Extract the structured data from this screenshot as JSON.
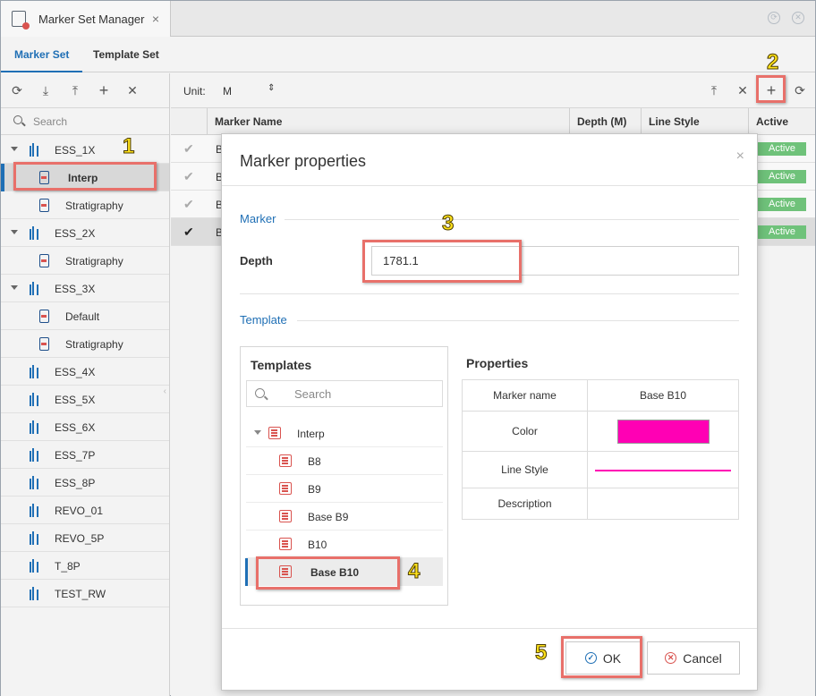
{
  "window": {
    "title": "Marker Set Manager",
    "close_glyph": "×",
    "controls": [
      "refresh-icon",
      "close-circle-icon"
    ]
  },
  "tabs": [
    {
      "label": "Marker Set",
      "active": true
    },
    {
      "label": "Template Set",
      "active": false
    }
  ],
  "left_toolbar": {
    "icons": [
      "refresh-icon",
      "import-icon",
      "export-icon",
      "add-icon",
      "close-icon"
    ],
    "glyphs": [
      "⟳",
      "⤓",
      "⤒",
      "+",
      "✕"
    ]
  },
  "left_search": {
    "placeholder": "Search"
  },
  "tree": [
    {
      "label": "ESS_1X",
      "type": "well",
      "expanded": true
    },
    {
      "label": "Interp",
      "type": "set",
      "selected": true
    },
    {
      "label": "Stratigraphy",
      "type": "set"
    },
    {
      "label": "ESS_2X",
      "type": "well",
      "expanded": true
    },
    {
      "label": "Stratigraphy",
      "type": "set"
    },
    {
      "label": "ESS_3X",
      "type": "well",
      "expanded": true
    },
    {
      "label": "Default",
      "type": "set"
    },
    {
      "label": "Stratigraphy",
      "type": "set"
    },
    {
      "label": "ESS_4X",
      "type": "well"
    },
    {
      "label": "ESS_5X",
      "type": "well"
    },
    {
      "label": "ESS_6X",
      "type": "well"
    },
    {
      "label": "ESS_7P",
      "type": "well"
    },
    {
      "label": "ESS_8P",
      "type": "well"
    },
    {
      "label": "REVO_01",
      "type": "well"
    },
    {
      "label": "REVO_5P",
      "type": "well"
    },
    {
      "label": "T_8P",
      "type": "well"
    },
    {
      "label": "TEST_RW",
      "type": "well"
    }
  ],
  "main_toolbar": {
    "unit_label": "Unit:",
    "unit_value": "M",
    "icons": [
      "export-icon",
      "close-icon",
      "add-icon",
      "refresh-icon"
    ],
    "glyphs": [
      "⤒",
      "✕",
      "+",
      "⟳"
    ]
  },
  "table": {
    "headers": [
      "Marker Name",
      "Depth (M)",
      "Line Style",
      "Active"
    ],
    "rows": [
      {
        "name": "B",
        "active": "Active",
        "checked": true,
        "selected": false
      },
      {
        "name": "B",
        "active": "Active",
        "checked": true,
        "selected": false
      },
      {
        "name": "B",
        "active": "Active",
        "checked": true,
        "selected": false
      },
      {
        "name": "B",
        "active": "Active",
        "checked": true,
        "selected": true
      }
    ],
    "check_glyph": "✔"
  },
  "dialog": {
    "title": "Marker properties",
    "close_glyph": "×",
    "marker_section": "Marker",
    "depth_label": "Depth",
    "depth_value": "1781.1",
    "template_section": "Template",
    "templates_title": "Templates",
    "templates_search_placeholder": "Search",
    "templates": [
      {
        "label": "Interp",
        "level": 0,
        "expanded": true
      },
      {
        "label": "B8",
        "level": 1
      },
      {
        "label": "B9",
        "level": 1
      },
      {
        "label": "Base B9",
        "level": 1
      },
      {
        "label": "B10",
        "level": 1
      },
      {
        "label": "Base B10",
        "level": 1,
        "selected": true
      }
    ],
    "properties_title": "Properties",
    "properties": {
      "marker_name_label": "Marker name",
      "marker_name_value": "Base B10",
      "color_label": "Color",
      "color_value": "#ff00b4",
      "line_style_label": "Line Style",
      "description_label": "Description",
      "description_value": ""
    },
    "ok_label": "OK",
    "cancel_label": "Cancel"
  },
  "callouts": [
    "1",
    "2",
    "3",
    "4",
    "5"
  ],
  "colors": {
    "accent": "#1f6fb5",
    "active_badge": "#6fc27a",
    "callout_border": "#e8706a",
    "callout_number": "#ffe21a"
  }
}
